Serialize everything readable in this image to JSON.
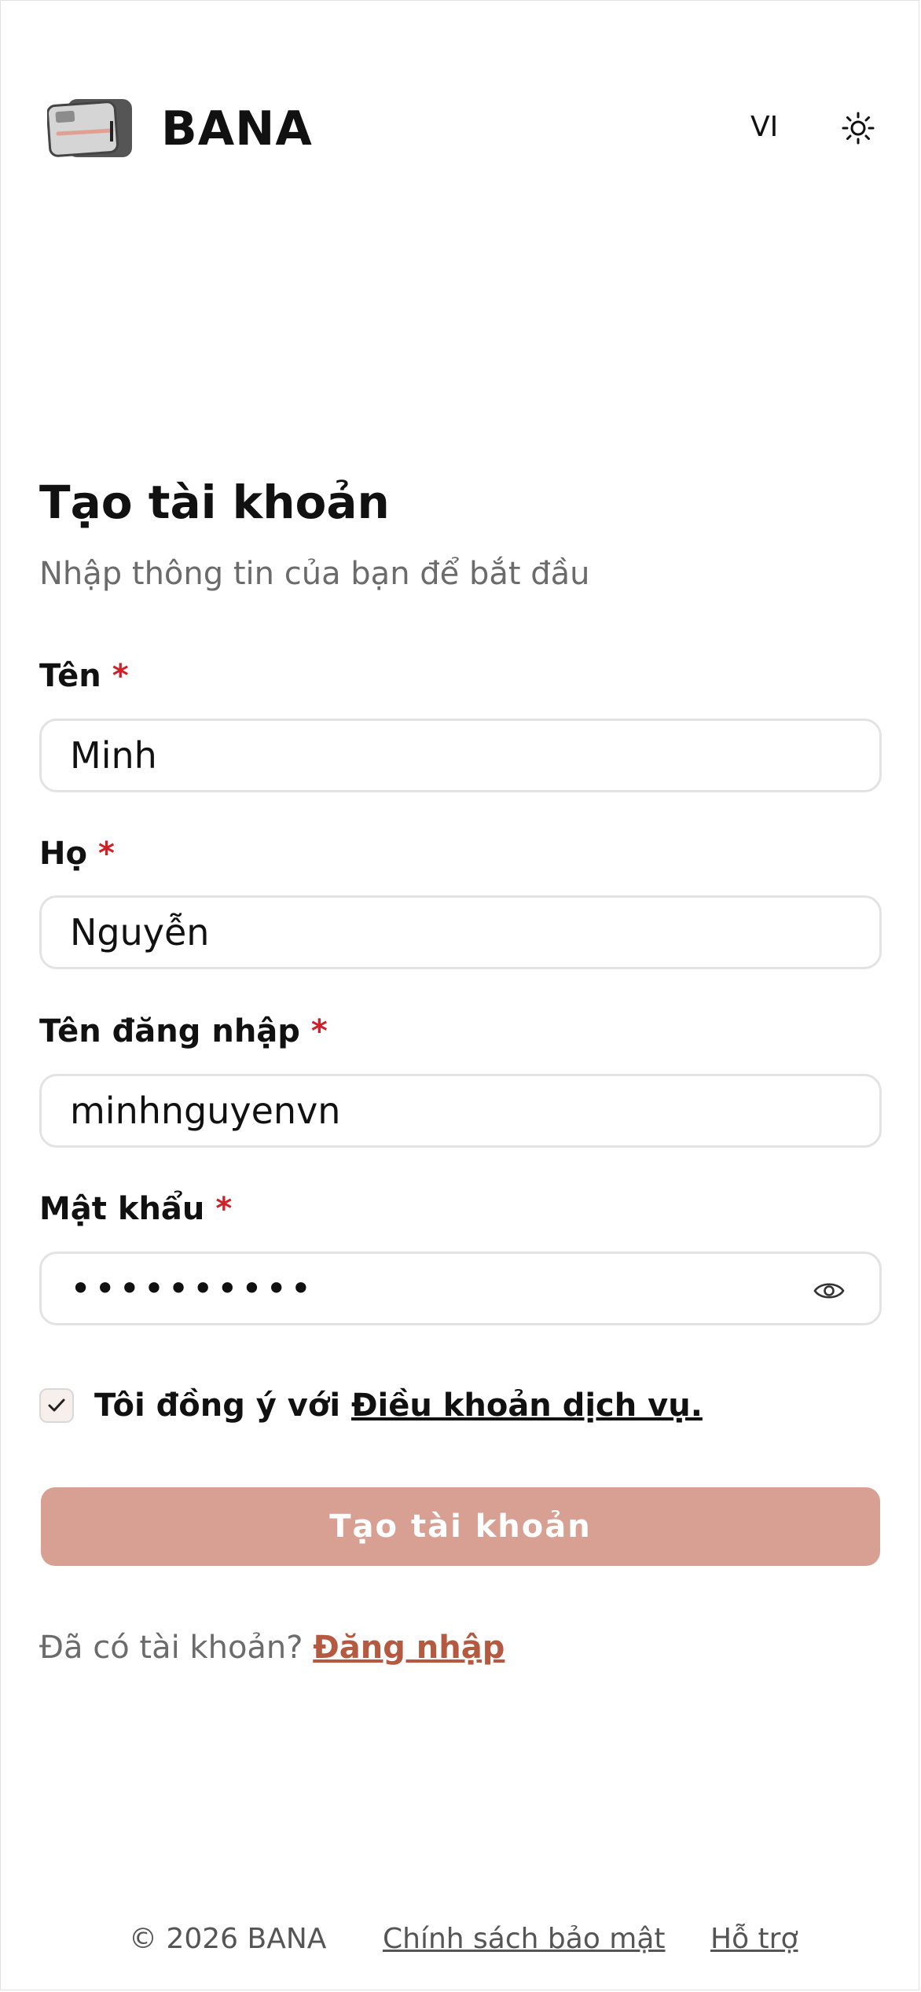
{
  "header": {
    "brand": "BANA",
    "language": "VI",
    "theme_icon": "sun-icon"
  },
  "form": {
    "title": "Tạo tài khoản",
    "subtitle": "Nhập thông tin của bạn để bắt đầu",
    "required_mark": "*",
    "first_name": {
      "label": "Tên",
      "value": "Minh"
    },
    "last_name": {
      "label": "Họ",
      "value": "Nguyễn"
    },
    "username": {
      "label": "Tên đăng nhập",
      "value": "minhnguyenvn"
    },
    "password": {
      "label": "Mật khẩu",
      "masked_value": "••••••••••",
      "toggle_icon": "eye-icon"
    },
    "terms": {
      "checked": true,
      "prefix": "Tôi đồng ý với ",
      "link": "Điều khoản dịch vụ."
    },
    "submit_label": "Tạo tài khoản",
    "have_account": "Đã có tài khoản?",
    "login_link": "Đăng nhập"
  },
  "footer": {
    "copyright": "© 2026 BANA",
    "privacy": "Chính sách bảo mật",
    "support": "Hỗ trợ"
  },
  "colors": {
    "accent": "#d8a092",
    "link_accent": "#b35a40",
    "required": "#d0202a",
    "muted_text": "#6b6b6b"
  }
}
